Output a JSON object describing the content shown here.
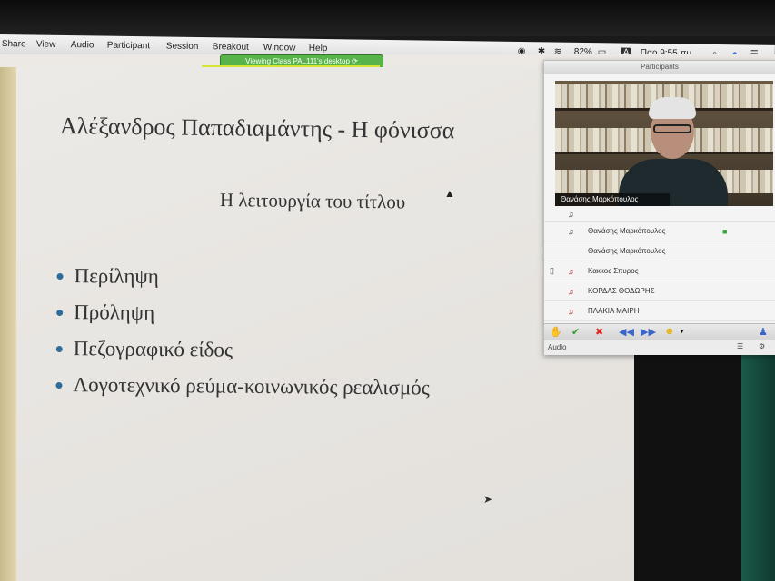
{
  "menubar": {
    "items": [
      "Share",
      "View",
      "Audio",
      "Participant",
      "Session",
      "Breakout",
      "Window",
      "Help"
    ],
    "battery": "82%",
    "keyboard_input": "A",
    "clock": "Παρ 9:55 πμ"
  },
  "banner": {
    "text": "Viewing Class PAL111's desktop"
  },
  "slide": {
    "title": "Αλέξανδρος Παπαδιαμάντης - Η φόνισσα",
    "subtitle": "Η λειτουργία του τίτλου",
    "bullets": [
      "Περίληψη",
      "Πρόληψη",
      "Πεζογραφικό είδος",
      "Λογοτεχνικό ρεύμα-κοινωνικός ρεαλισμός"
    ]
  },
  "participants": {
    "title": "Participants",
    "video_name": "Θανάσης Μαρκόπουλος",
    "rows": [
      {
        "name": "Θανάσης Μαρκόπουλος",
        "mic": true,
        "device": false,
        "camera": true
      },
      {
        "name": "Θανάσης Μαρκόπουλος",
        "mic": false,
        "device": false,
        "camera": false
      },
      {
        "name": "Κακκος Σπυρος",
        "mic": true,
        "device": true,
        "camera": false
      },
      {
        "name": "ΚΟΡΔΑΣ ΘΟΔΩΡΗΣ",
        "mic": true,
        "device": false,
        "camera": false
      },
      {
        "name": "ΠΛΑΚΙΑ ΜΑΙΡΗ",
        "mic": true,
        "device": false,
        "camera": false
      }
    ],
    "footer_label": "Audio"
  },
  "colors": {
    "banner": "#58b34a",
    "highlight": "#d6e434",
    "bullet": "#2c6b9a"
  }
}
